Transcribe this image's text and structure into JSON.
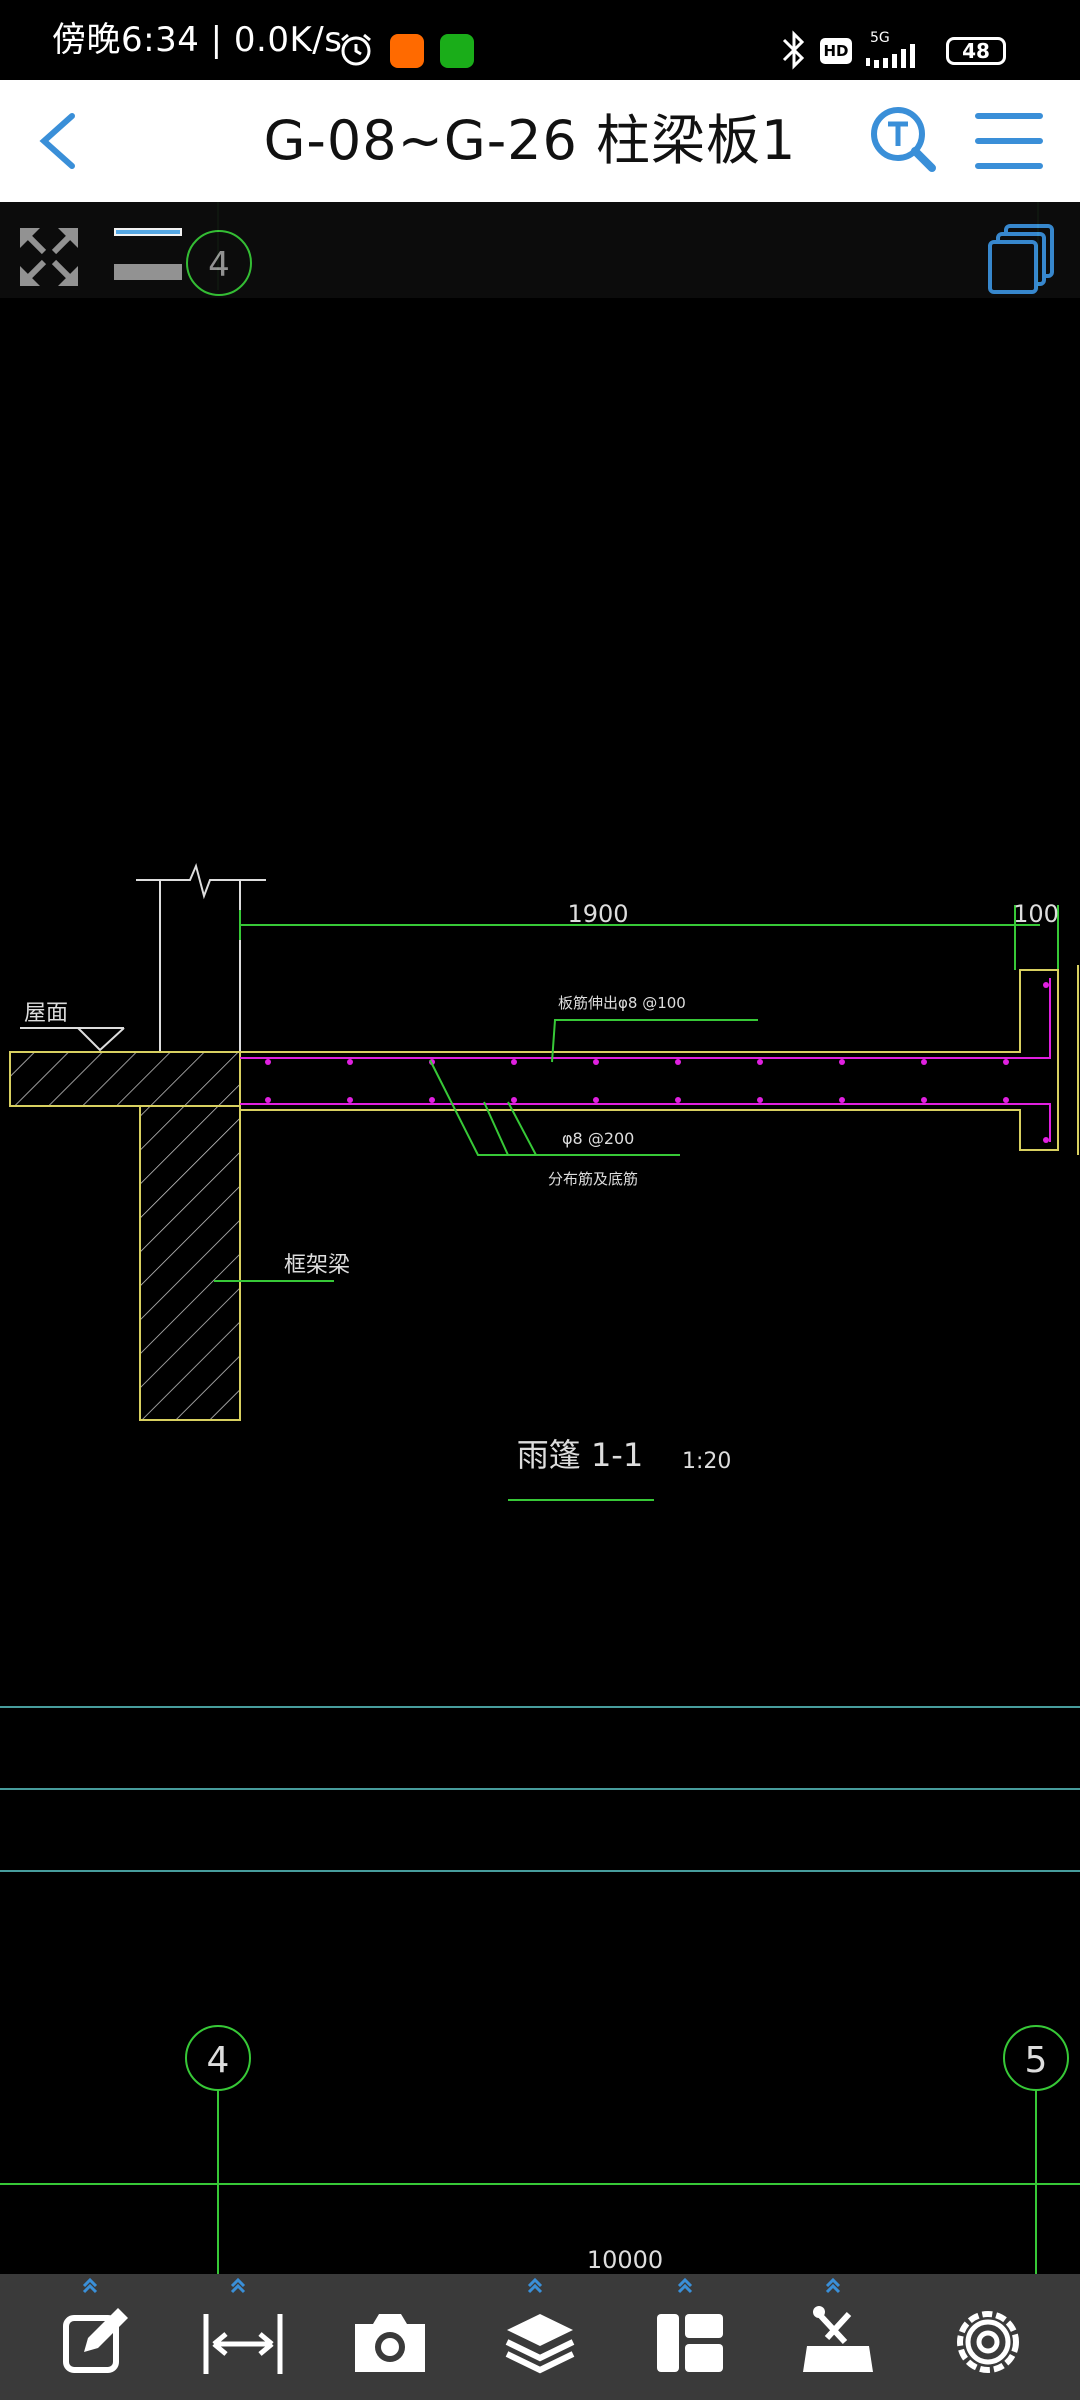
{
  "status_bar": {
    "text": "傍晚6:34 | 0.0K/s",
    "network": "5G",
    "hd": "HD",
    "battery": "48"
  },
  "header": {
    "title": "G-08~G-26 柱梁板1"
  },
  "toolbar": {
    "icons": [
      "fullscreen-icon",
      "layer-color-icon",
      "layout-stack-icon"
    ]
  },
  "drawing": {
    "grid_top_label": "4",
    "dim_1900": "1900",
    "dim_100": "100",
    "roof_label": "屋面",
    "rebar_top": "板筋伸出φ8 @100",
    "rebar_mid": "φ8 @200",
    "rebar_bottom": "分布筋及底筋",
    "beam_label": "框架梁",
    "section_title": "雨篷 1-1",
    "scale": "1:20",
    "axis_left": "4",
    "axis_right": "5",
    "dim_bottom": "10000"
  },
  "bottom_tools": [
    {
      "name": "edit-icon"
    },
    {
      "name": "measure-icon"
    },
    {
      "name": "camera-icon"
    },
    {
      "name": "layers-icon"
    },
    {
      "name": "panel-layout-icon"
    },
    {
      "name": "toolbox-icon"
    },
    {
      "name": "settings-icon"
    }
  ],
  "colors": {
    "accent": "#3a8fd8",
    "cad_green": "#37c837",
    "cad_magenta": "#e020e0",
    "cad_yellow": "#d8d060",
    "cad_cyan": "#5fd0d0"
  }
}
